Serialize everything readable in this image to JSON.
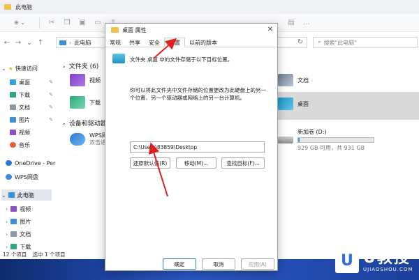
{
  "explorer": {
    "title": "此电脑",
    "toolbar": {
      "new_label": "⊕ ⌄"
    },
    "breadcrumb": [
      "此电脑"
    ],
    "search_placeholder": "搜索\"此电脑\"",
    "nav": {
      "quick_access": "快速访问",
      "items": [
        {
          "label": "桌面",
          "pinned": true
        },
        {
          "label": "下载",
          "pinned": true
        },
        {
          "label": "文档",
          "pinned": true
        },
        {
          "label": "图片",
          "pinned": true
        },
        {
          "label": "视频"
        },
        {
          "label": "音乐"
        }
      ],
      "onedrive": "OneDrive - Per",
      "wps": "WPS网盘",
      "this_pc": "此电脑",
      "pc_items": [
        "视频",
        "图片",
        "文档",
        "下载"
      ]
    },
    "content": {
      "folders_group": "文件夹 (6)",
      "folders": [
        "视频",
        "下载",
        "文档",
        "桌面"
      ],
      "devices_group": "设备和驱动器",
      "wps_tile": {
        "name": "WPS网",
        "sub": "双击进"
      },
      "drive": {
        "name": "新加卷 (D:)",
        "free": "929 GB 可用，共 931 GB",
        "used_fraction": 0.02
      }
    },
    "status": {
      "count": "12 个项目",
      "selected": "选中 1 个项目"
    }
  },
  "dialog": {
    "title": "桌面 属性",
    "tabs": [
      "常规",
      "共享",
      "安全",
      "位置",
      "以前的版本"
    ],
    "active_tab": "位置",
    "info": "文件夹 桌面 中的文件存储于以下目标位置。",
    "desc": "你可以将此文件夹中文件存储的位置更改为此硬盘上的另一个位置、另一个驱动器或网络上的另一台计算机。",
    "path": "C:\\Users\\83859\\Desktop",
    "buttons": {
      "restore": "还原默认值(R)",
      "move": "移动(M)...",
      "find": "查找目标(F)..."
    },
    "footer": {
      "ok": "确定",
      "cancel": "取消",
      "apply": "应用(A)"
    }
  },
  "watermark": {
    "brand": "U教授",
    "url": "UJIAOSHOU.COM",
    "colors": {
      "accent": "#e02020"
    }
  }
}
